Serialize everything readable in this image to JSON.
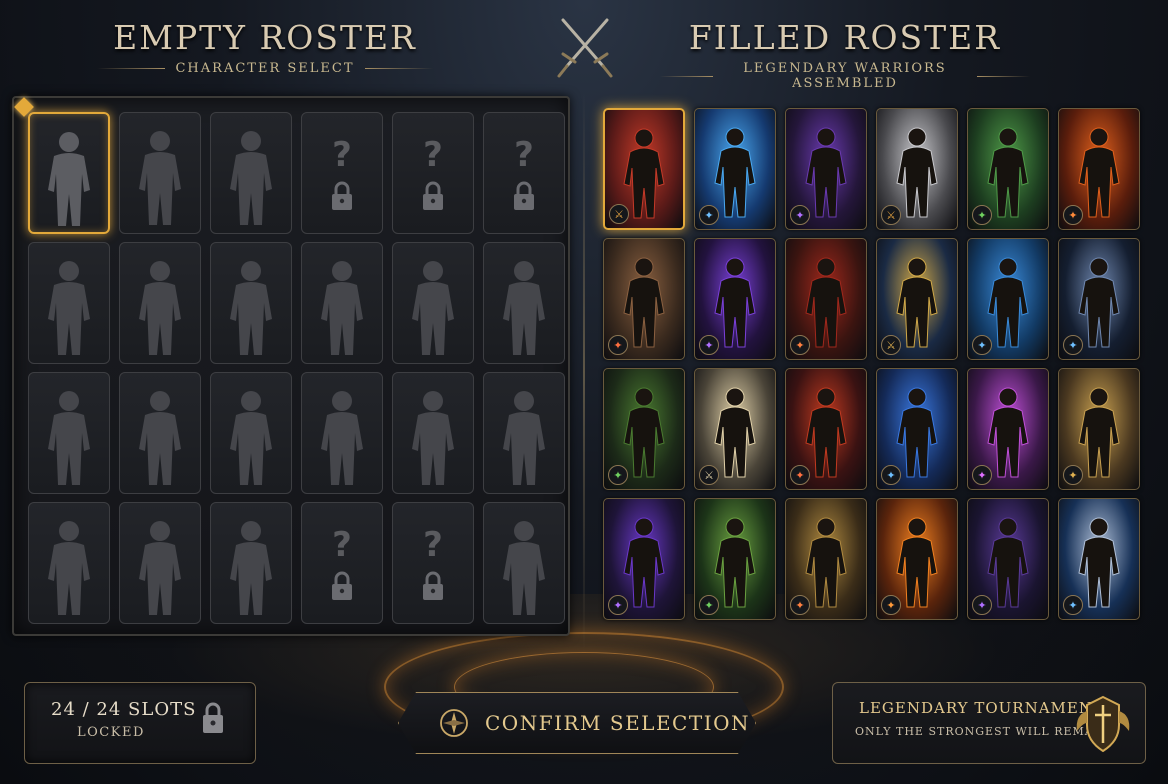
{
  "left_header": {
    "title": "EMPTY ROSTER",
    "subtitle": "CHARACTER SELECT"
  },
  "right_header": {
    "title": "FILLED ROSTER",
    "subtitle": "LEGENDARY WARRIORS ASSEMBLED"
  },
  "empty_roster": {
    "slots": [
      {
        "state": "selected"
      },
      {
        "state": "empty"
      },
      {
        "state": "empty"
      },
      {
        "state": "locked"
      },
      {
        "state": "locked"
      },
      {
        "state": "locked"
      },
      {
        "state": "empty"
      },
      {
        "state": "empty"
      },
      {
        "state": "empty"
      },
      {
        "state": "empty"
      },
      {
        "state": "empty"
      },
      {
        "state": "empty"
      },
      {
        "state": "empty"
      },
      {
        "state": "empty"
      },
      {
        "state": "empty"
      },
      {
        "state": "empty"
      },
      {
        "state": "empty"
      },
      {
        "state": "empty"
      },
      {
        "state": "empty"
      },
      {
        "state": "empty"
      },
      {
        "state": "empty"
      },
      {
        "state": "locked"
      },
      {
        "state": "locked"
      },
      {
        "state": "empty"
      }
    ],
    "locked_glyph": "?"
  },
  "filled_roster": {
    "cards": [
      {
        "bg": "#5a1a18",
        "accent": "#c43a28",
        "badge_color": "#e0a040",
        "badge": "sword",
        "selected": true
      },
      {
        "bg": "#153a70",
        "accent": "#4aa8f0",
        "badge_color": "#6fc0ff",
        "badge": "crystal"
      },
      {
        "bg": "#24163a",
        "accent": "#6a3ab0",
        "badge_color": "#b070ff",
        "badge": "crystal"
      },
      {
        "bg": "#4a4a4e",
        "accent": "#c8c8cc",
        "badge_color": "#e0a040",
        "badge": "sword"
      },
      {
        "bg": "#1d3e20",
        "accent": "#4f9a48",
        "badge_color": "#70d060",
        "badge": "crystal"
      },
      {
        "bg": "#5a1d0c",
        "accent": "#e0601c",
        "badge_color": "#ff8a3a",
        "badge": "crystal"
      },
      {
        "bg": "#3a2a1e",
        "accent": "#8a6040",
        "badge_color": "#ff7040",
        "badge": "crystal"
      },
      {
        "bg": "#22123e",
        "accent": "#7a40d8",
        "badge_color": "#b070ff",
        "badge": "crystal"
      },
      {
        "bg": "#3a1410",
        "accent": "#a0281c",
        "badge_color": "#ff8040",
        "badge": "crystal"
      },
      {
        "bg": "#1a2a44",
        "accent": "#d0a848",
        "badge_color": "#e0b050",
        "badge": "sword"
      },
      {
        "bg": "#123a64",
        "accent": "#3a8ad8",
        "badge_color": "#6fc0ff",
        "badge": "crystal"
      },
      {
        "bg": "#141e30",
        "accent": "#7088b0",
        "badge_color": "#6fc0ff",
        "badge": "crystal"
      },
      {
        "bg": "#1c2a18",
        "accent": "#4a7a30",
        "badge_color": "#70d060",
        "badge": "crystal"
      },
      {
        "bg": "#4a4438",
        "accent": "#e0d0a8",
        "badge_color": "#d8c8a0",
        "badge": "sword"
      },
      {
        "bg": "#3a1212",
        "accent": "#c03a20",
        "badge_color": "#ff7040",
        "badge": "crystal"
      },
      {
        "bg": "#142a58",
        "accent": "#3a78e0",
        "badge_color": "#6fc0ff",
        "badge": "crystal"
      },
      {
        "bg": "#3a1848",
        "accent": "#c050d8",
        "badge_color": "#e070ff",
        "badge": "crystal"
      },
      {
        "bg": "#4a3820",
        "accent": "#c8a050",
        "badge_color": "#e0b050",
        "badge": "crystal"
      },
      {
        "bg": "#1e1438",
        "accent": "#6a38c8",
        "badge_color": "#b070ff",
        "badge": "crystal"
      },
      {
        "bg": "#1c3418",
        "accent": "#6aa040",
        "badge_color": "#70d060",
        "badge": "crystal"
      },
      {
        "bg": "#3a2c18",
        "accent": "#b08a40",
        "badge_color": "#ff8040",
        "badge": "crystal"
      },
      {
        "bg": "#5a240c",
        "accent": "#f08020",
        "badge_color": "#ff9a3a",
        "badge": "crystal"
      },
      {
        "bg": "#1a1430",
        "accent": "#5a3a98",
        "badge_color": "#b070ff",
        "badge": "crystal"
      },
      {
        "bg": "#163056",
        "accent": "#b0c0d8",
        "badge_color": "#6fc0ff",
        "badge": "crystal"
      }
    ]
  },
  "status": {
    "count": "24 / 24 SLOTS",
    "label": "LOCKED"
  },
  "confirm_button": {
    "label": "CONFIRM SELECTION"
  },
  "tournament": {
    "title": "LEGENDARY TOURNAMENT",
    "subtitle": "ONLY THE STRONGEST WILL REMAIN"
  },
  "icons": {
    "swords": "crossed-swords-icon",
    "lock": "padlock-icon",
    "emblem": "compass-emblem-icon",
    "crest": "winged-crest-icon"
  },
  "colors": {
    "gold": "#e3a93a",
    "panel": "#1b1d22",
    "text": "#d9cbb2"
  }
}
